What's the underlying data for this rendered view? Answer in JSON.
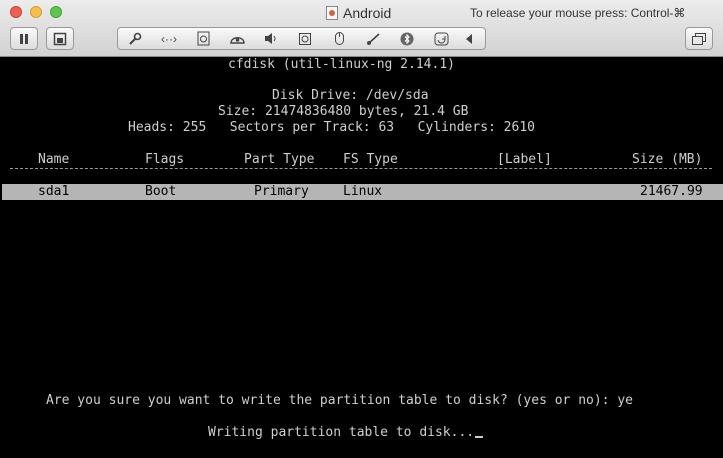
{
  "window": {
    "title": "Android",
    "release_hint": "To release your mouse press: Control-⌘",
    "title_icon": "vm-document-icon"
  },
  "toolbar": {
    "left_buttons": [
      "pause-icon",
      "snapshot-icon"
    ],
    "segmented_icons": [
      "wrench-icon",
      "network-arrows-icon",
      "disk-icon",
      "camera-icon",
      "speaker-icon",
      "cd-icon",
      "usb-icon",
      "connection-icon",
      "bluetooth-icon",
      "refresh-icon",
      "chevron-left-icon"
    ],
    "right_button": "fullscreen-icon"
  },
  "terminal": {
    "header": "cfdisk (util-linux-ng 2.14.1)",
    "disk_drive": "Disk Drive: /dev/sda",
    "size": "Size: 21474836480 bytes, 21.4 GB",
    "geometry": "Heads: 255   Sectors per Track: 63   Cylinders: 2610",
    "columns": {
      "name": "Name",
      "flags": "Flags",
      "part_type": "Part Type",
      "fs_type": "FS Type",
      "label": "[Label]",
      "size": "Size (MB)"
    },
    "partition": {
      "name": "sda1",
      "flags": "Boot",
      "part_type": "Primary",
      "fs_type": "Linux",
      "size": "21467.99"
    },
    "prompt": "Are you sure you want to write the partition table to disk? (yes or no): ye",
    "status": "Writing partition table to disk..."
  }
}
